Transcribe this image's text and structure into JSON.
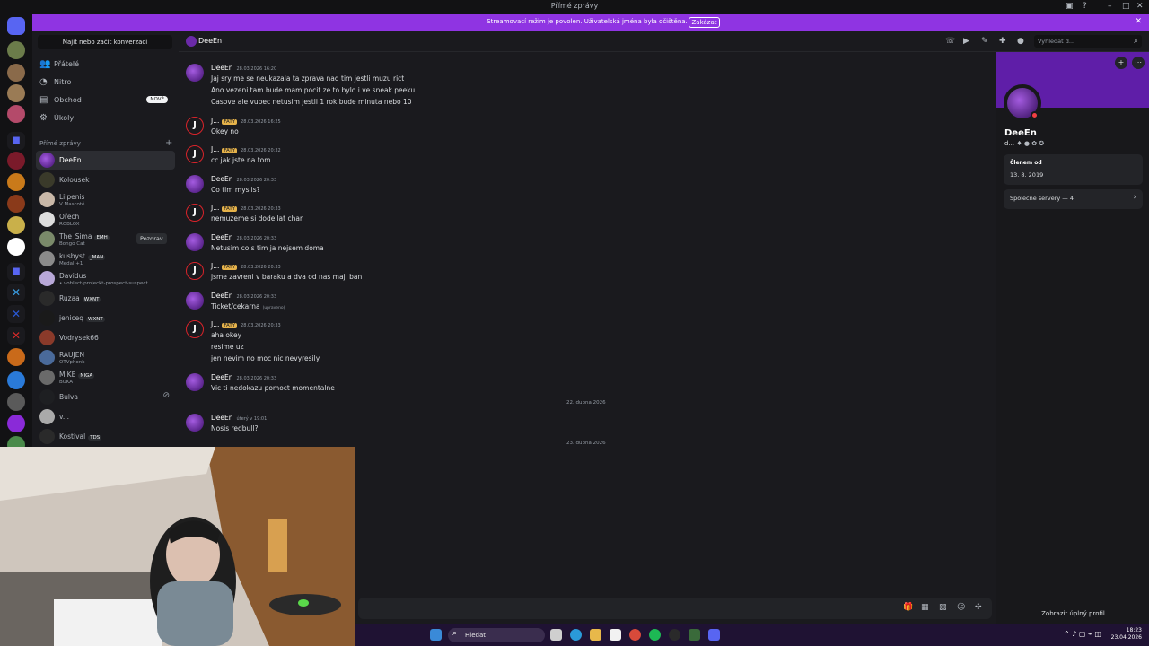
{
  "window": {
    "title": "Přímé zprávy"
  },
  "banner": {
    "message": "Streamovací režim je povolen. Uživatelská jména byla očištěna.",
    "button": "Zakázat"
  },
  "sidebar": {
    "search_placeholder": "Najít nebo začít konverzaci",
    "nav": [
      {
        "label": "Přátelé",
        "icon": "friends-icon"
      },
      {
        "label": "Nitro",
        "icon": "nitro-icon"
      },
      {
        "label": "Obchod",
        "icon": "shop-icon",
        "badge": "NOVÉ"
      },
      {
        "label": "Úkoly",
        "icon": "quests-icon"
      }
    ],
    "dm_header": "Přímé zprávy",
    "dms": [
      {
        "name": "DeeEn",
        "sub": "",
        "tag": ""
      },
      {
        "name": "Kolousek",
        "sub": "",
        "tag": ""
      },
      {
        "name": "Lilpenis",
        "sub": "V Mascotě",
        "tag": ""
      },
      {
        "name": "Ořech",
        "sub": "ROBLOX",
        "tag": ""
      },
      {
        "name": "The_Sima",
        "sub": "Bongo Cat",
        "tag": "EMH",
        "action": "Pozdrav"
      },
      {
        "name": "kusbyst",
        "sub": "Medal +1",
        "tag": "_MAN"
      },
      {
        "name": "Davidus",
        "sub": "• voblect-projeckt-prospect-suspect",
        "tag": ""
      },
      {
        "name": "Ruzaa",
        "sub": "",
        "tag": "WXNT"
      },
      {
        "name": "jeniceq",
        "sub": "",
        "tag": "WXNT"
      },
      {
        "name": "Vodrysek66",
        "sub": "",
        "tag": ""
      },
      {
        "name": "RAUJEN",
        "sub": "OTVphonk",
        "tag": ""
      },
      {
        "name": "MIKE",
        "sub": "BUKA",
        "tag": "NIGA"
      },
      {
        "name": "Bulva",
        "sub": "",
        "tag": ""
      },
      {
        "name": "v...",
        "sub": "",
        "tag": ""
      },
      {
        "name": "Kostival",
        "sub": "",
        "tag": "TDS"
      }
    ]
  },
  "chat": {
    "recipient": "DeeEn",
    "search_placeholder": "Vyhledat d...",
    "messages": [
      {
        "author": "DeeEn",
        "time": "28.03.2026 16:20",
        "badge": "",
        "lines": [
          "Jaj sry me se neukazala ta zprava nad tim jestli muzu rict",
          "Ano vezeni tam bude mam pocit ze to bylo i ve sneak peeku",
          "Casove ale vubec netusim jestli 1 rok bude minuta nebo 10"
        ]
      },
      {
        "author": "J...",
        "time": "28.03.2026 16:25",
        "badge": "FATY",
        "lines": [
          "Okey no"
        ]
      },
      {
        "author": "J...",
        "time": "28.03.2026 20:32",
        "badge": "FATY",
        "lines": [
          "cc jak jste na tom"
        ]
      },
      {
        "author": "DeeEn",
        "time": "28.03.2026 20:33",
        "badge": "",
        "lines": [
          "Co tim myslis?"
        ]
      },
      {
        "author": "J...",
        "time": "28.03.2026 20:33",
        "badge": "FATY",
        "lines": [
          "nemuzeme si dodellat char"
        ]
      },
      {
        "author": "DeeEn",
        "time": "28.03.2026 20:33",
        "badge": "",
        "lines": [
          "Netusim co s tim ja nejsem doma"
        ]
      },
      {
        "author": "J...",
        "time": "28.03.2026 20:33",
        "badge": "FATY",
        "lines": [
          "jsme zavreni v baraku a dva od nas maji ban"
        ]
      },
      {
        "author": "DeeEn",
        "time": "28.03.2026 20:33",
        "badge": "",
        "lines": [
          "Ticket/cekarna"
        ],
        "edited": "(upraveno)"
      },
      {
        "author": "J...",
        "time": "28.03.2026 20:33",
        "badge": "FATY",
        "lines": [
          "aha okey",
          "resime uz",
          "jen nevim no moc nic nevyresily"
        ]
      },
      {
        "author": "DeeEn",
        "time": "28.03.2026 20:33",
        "badge": "",
        "lines": [
          "Vic ti nedokazu pomoct momentalne"
        ]
      },
      {
        "author": "DeeEn",
        "time": "úterý v 19:01",
        "badge": "",
        "lines": [
          "Nosis redbull?"
        ]
      }
    ],
    "separators": [
      "22. dubna 2026",
      "23. dubna 2026"
    ]
  },
  "profile": {
    "name": "DeeEn",
    "short": "d...",
    "member_label": "Členem od",
    "member_since": "13. 8. 2019",
    "mutual": "Společné servery — 4",
    "full_profile": "Zobrazit úplný profil"
  },
  "taskbar": {
    "search": "Hledat",
    "time": "18:23",
    "date": "23.04.2026"
  }
}
